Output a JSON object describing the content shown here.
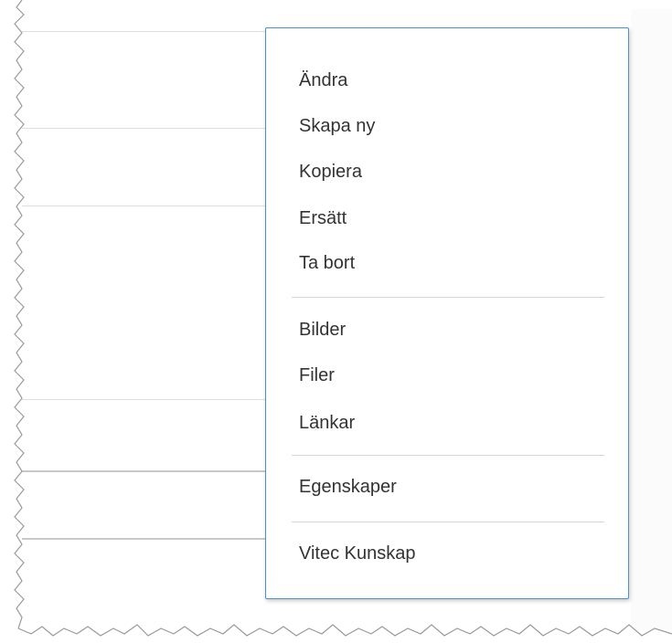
{
  "context_menu": {
    "groups": [
      [
        "Ändra",
        "Skapa ny",
        "Kopiera",
        "Ersätt",
        "Ta bort"
      ],
      [
        "Bilder",
        "Filer",
        "Länkar"
      ],
      [
        "Egenskaper"
      ],
      [
        "Vitec Kunskap"
      ]
    ]
  },
  "colors": {
    "menu_border": "#4a90d9",
    "menu_text": "#333333",
    "separator": "#d6d6d6"
  }
}
